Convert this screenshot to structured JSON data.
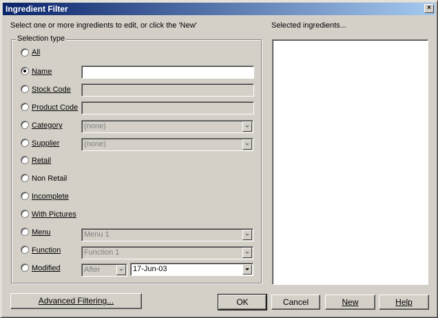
{
  "window": {
    "title": "Ingredient Filter",
    "close_glyph": "×"
  },
  "instructions": "Select one or more ingredients to edit, or click the 'New'",
  "selected_label": "Selected ingredients...",
  "group": {
    "legend": "Selection type"
  },
  "options": {
    "all": "All",
    "name": "Name",
    "stock_code": "Stock Code",
    "product_code": "Product Code",
    "category": "Category",
    "supplier": "Supplier",
    "retail": "Retail",
    "non_retail": "Non Retail",
    "incomplete": "Incomplete",
    "with_pictures": "With Pictures",
    "menu": "Menu",
    "function": "Function",
    "modified": "Modified"
  },
  "selected_option": "name",
  "fields": {
    "name_value": "",
    "stock_code_value": "",
    "product_code_value": "",
    "category_value": "(none)",
    "supplier_value": "(none)",
    "menu_value": "Menu 1",
    "function_value": "Function 1",
    "modified_when": "After",
    "modified_date": "17-Jun-03"
  },
  "buttons": {
    "advanced": "Advanced Filtering...",
    "ok": "OK",
    "cancel": "Cancel",
    "new": "New",
    "help": "Help"
  },
  "colors": {
    "titlebar_start": "#0a246a",
    "titlebar_end": "#a6caf0",
    "face": "#d4d0c8"
  }
}
